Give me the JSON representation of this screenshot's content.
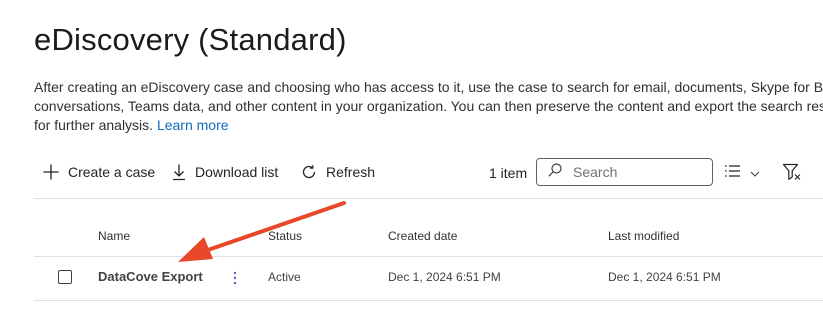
{
  "page": {
    "title": "eDiscovery (Standard)",
    "description_lines": [
      "After creating an eDiscovery case and choosing who has access to it, use the case to search for email, documents, Skype for Busi",
      "conversations, Teams data, and other content in your organization. You can then preserve the content and export the search resu",
      "for further analysis."
    ],
    "learn_more": "Learn more"
  },
  "toolbar": {
    "create_label": "Create a case",
    "download_label": "Download list",
    "refresh_label": "Refresh",
    "item_count": "1 item",
    "search_placeholder": "Search"
  },
  "table": {
    "columns": [
      "Name",
      "Status",
      "Created date",
      "Last modified"
    ],
    "rows": [
      {
        "name": "DataCove Export",
        "status": "Active",
        "created": "Dec 1, 2024 6:51 PM",
        "modified": "Dec 1, 2024 6:51 PM"
      }
    ]
  },
  "icons": {
    "create": "plus-icon",
    "download": "download-icon",
    "refresh": "refresh-icon",
    "search": "search-icon",
    "view": "list-view-icon",
    "filter": "filter-icon",
    "more": "more-vertical-icon"
  },
  "colors": {
    "link": "#0f6cbd",
    "more_icon": "#5b5fc7",
    "annotation_arrow": "#e8472a"
  }
}
